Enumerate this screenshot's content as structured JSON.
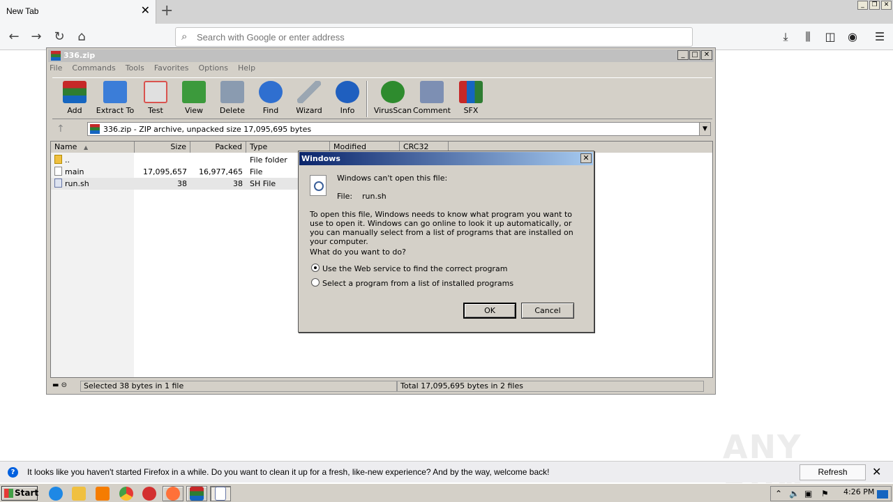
{
  "browser": {
    "tab_title": "New Tab",
    "url_placeholder": "Search with Google or enter address"
  },
  "winrar": {
    "title": "336.zip",
    "menu": [
      "File",
      "Commands",
      "Tools",
      "Favorites",
      "Options",
      "Help"
    ],
    "toolbar": [
      {
        "label": "Add",
        "icon": "add-archive-icon",
        "color": "#c0392b"
      },
      {
        "label": "Extract To",
        "icon": "extract-folder-icon",
        "color": "#3b7dd8"
      },
      {
        "label": "Test",
        "icon": "test-clipboard-icon",
        "color": "#d9534f"
      },
      {
        "label": "View",
        "icon": "view-book-icon",
        "color": "#3c9a3c"
      },
      {
        "label": "Delete",
        "icon": "trash-can-icon",
        "color": "#8a9bb0"
      },
      {
        "label": "Find",
        "icon": "magnifier-icon",
        "color": "#2f6fd0"
      },
      {
        "label": "Wizard",
        "icon": "magic-wand-icon",
        "color": "#9aa6b2"
      },
      {
        "label": "Info",
        "icon": "info-icon",
        "color": "#1f5fbf"
      },
      {
        "label": "VirusScan",
        "icon": "virus-scan-icon",
        "color": "#2e8b2e"
      },
      {
        "label": "Comment",
        "icon": "comment-icon",
        "color": "#7d8fb3"
      },
      {
        "label": "SFX",
        "icon": "sfx-books-icon",
        "color": "#c0392b"
      }
    ],
    "address": "336.zip - ZIP archive, unpacked size 17,095,695 bytes",
    "columns": [
      "Name",
      "Size",
      "Packed",
      "Type",
      "Modified",
      "CRC32"
    ],
    "rows": [
      {
        "name": "..",
        "size": "",
        "packed": "",
        "type": "File folder",
        "icon": "folder"
      },
      {
        "name": "main",
        "size": "17,095,657",
        "packed": "16,977,465",
        "type": "File",
        "icon": "file"
      },
      {
        "name": "run.sh",
        "size": "38",
        "packed": "38",
        "type": "SH File",
        "icon": "sh"
      }
    ],
    "status_left": "Selected 38 bytes in 1 file",
    "status_right": "Total 17,095,695 bytes in 2 files"
  },
  "dialog": {
    "title": "Windows",
    "heading": "Windows can't open this file:",
    "file_label": "File:",
    "file_name": "run.sh",
    "description": "To open this file, Windows needs to know what program you want to use to open it. Windows can go online to look it up automatically, or you can manually select from a list of programs that are installed on your computer.",
    "question": "What do you want to do?",
    "options": [
      {
        "label": "Use the Web service to find the correct program",
        "selected": true
      },
      {
        "label": "Select a program from a list of installed programs",
        "selected": false
      }
    ],
    "ok_label": "OK",
    "cancel_label": "Cancel"
  },
  "watermark": "ANY RUN",
  "notification": {
    "text": "It looks like you haven't started Firefox in a while. Do you want to clean it up for a fresh, like-new experience? And by the way, welcome back!",
    "button": "Refresh Firefox…"
  },
  "taskbar": {
    "start_label": "Start",
    "clock": "4:26 PM"
  }
}
